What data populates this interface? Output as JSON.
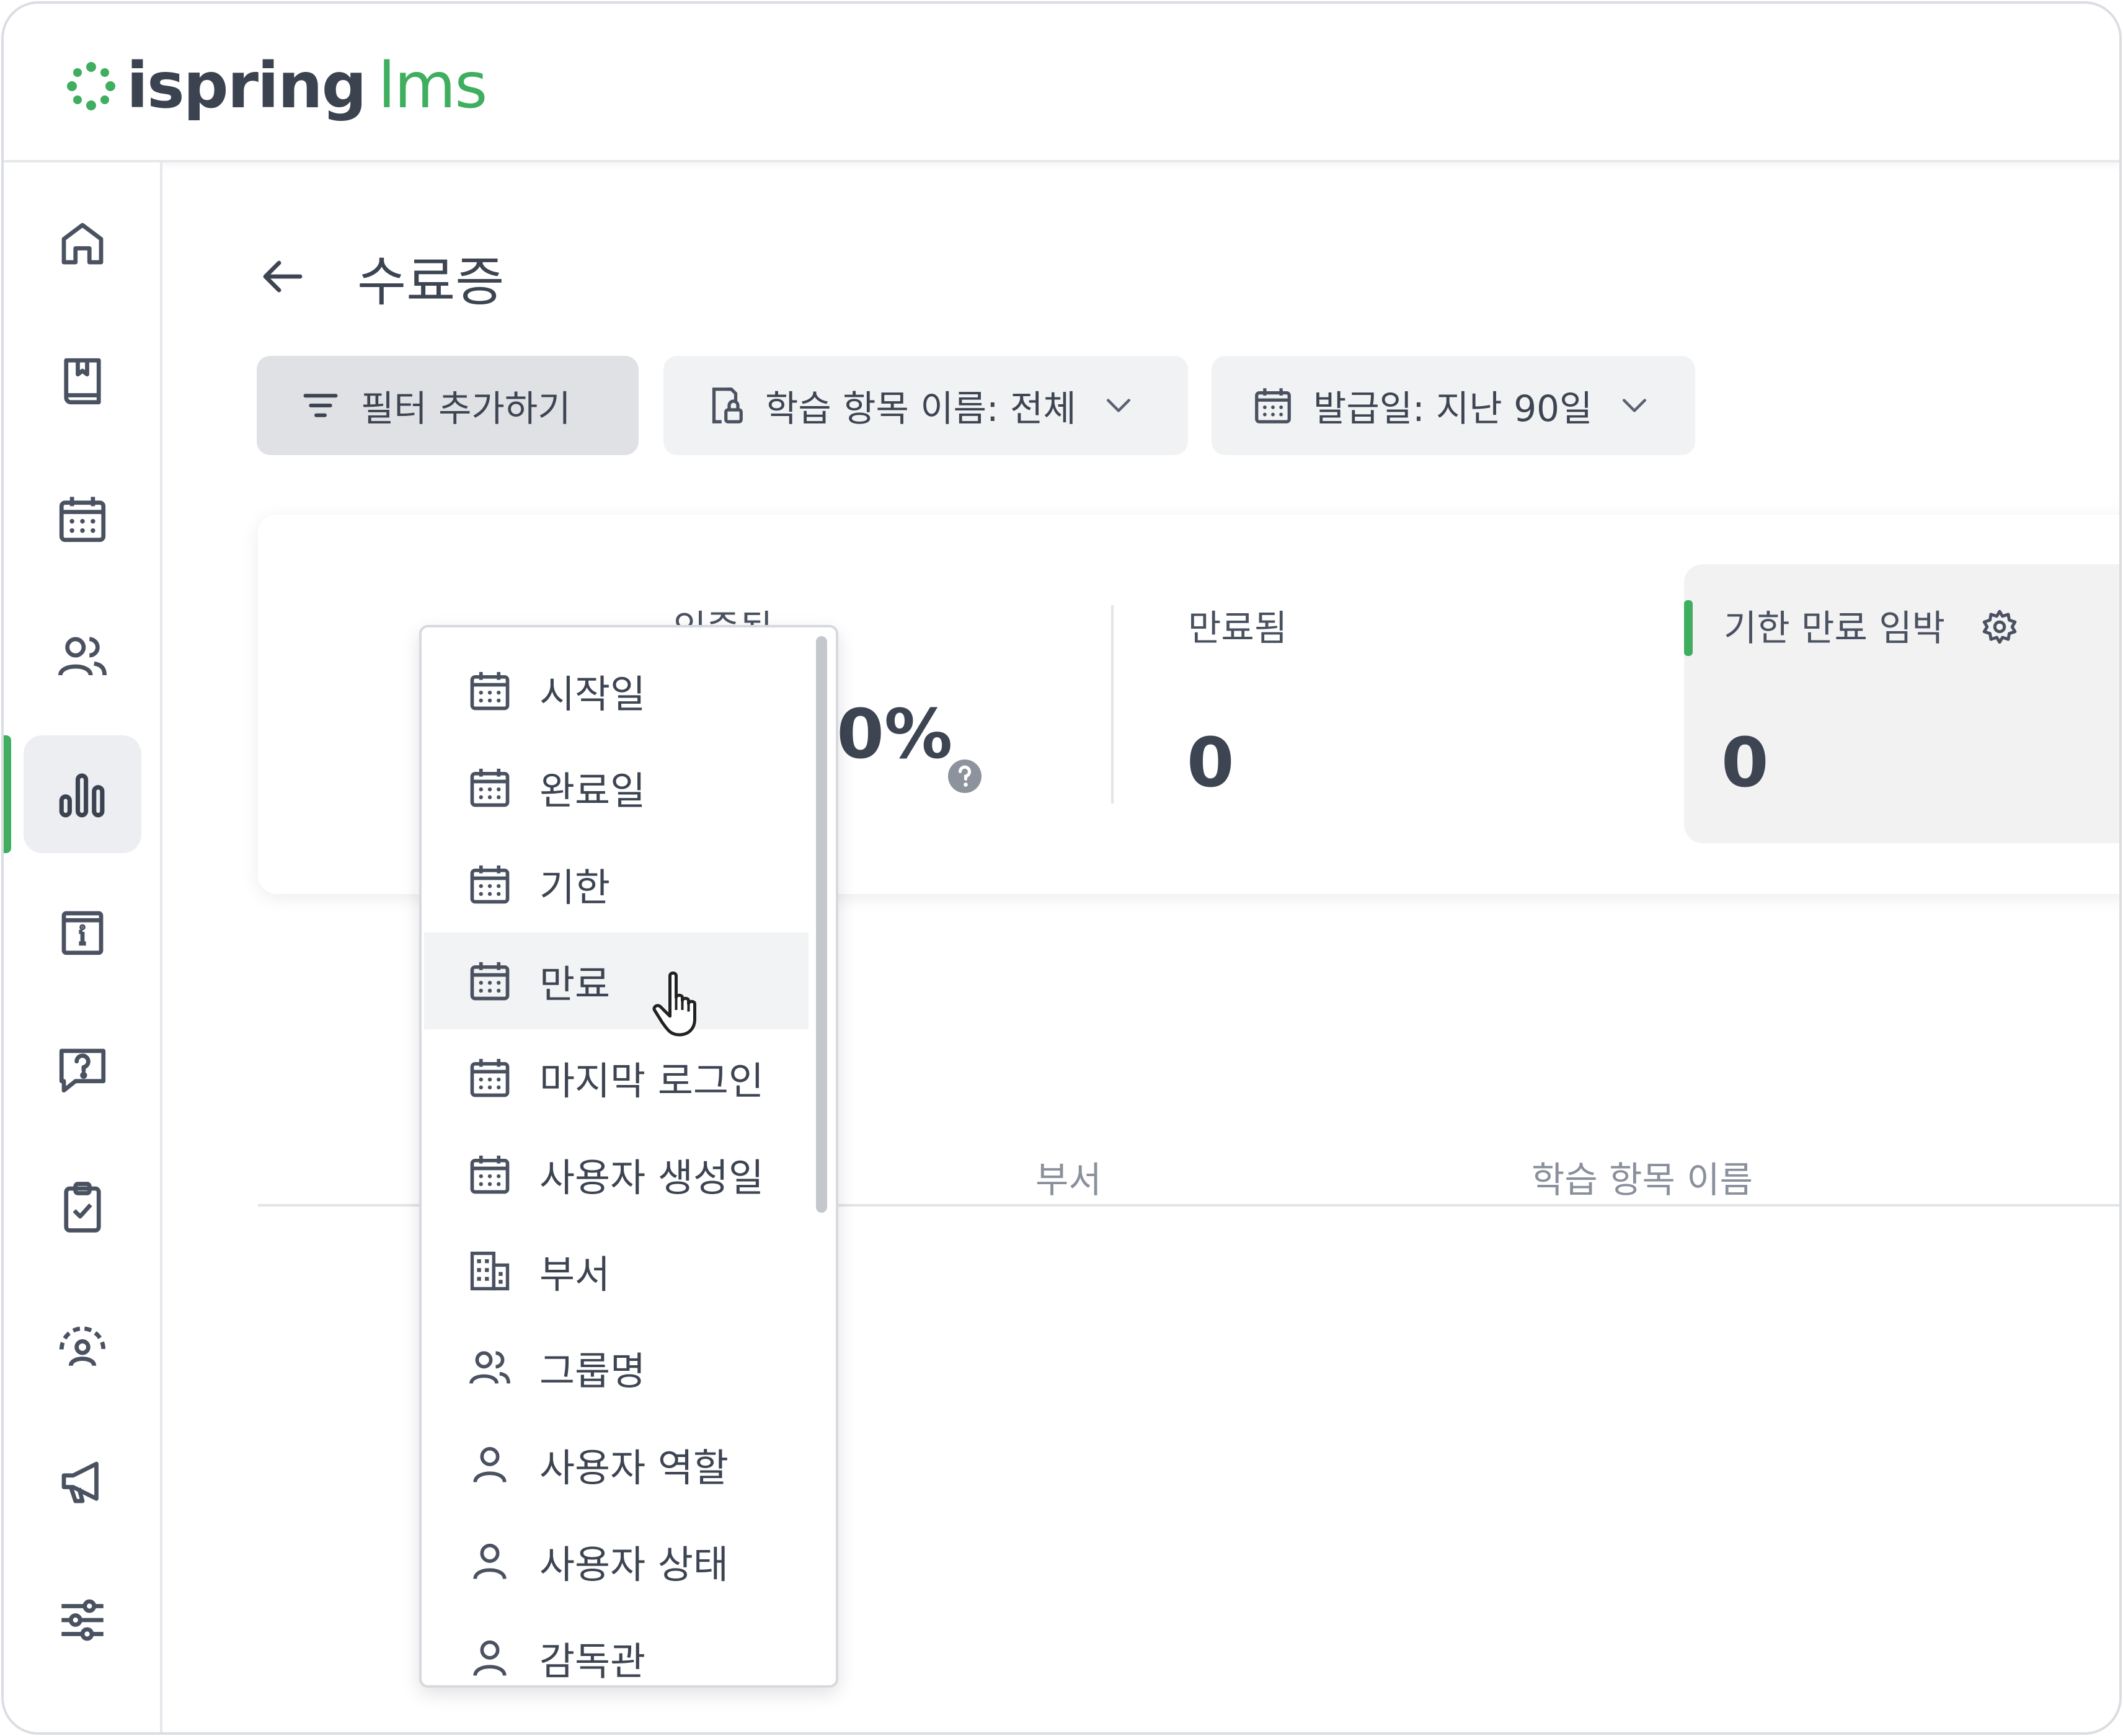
{
  "app": {
    "logo_text": "ispring",
    "logo_suffix": "lms",
    "brand_color": "#3fae5f"
  },
  "sidebar": {
    "items": [
      {
        "name": "home-icon",
        "active": false
      },
      {
        "name": "book-icon",
        "active": false
      },
      {
        "name": "calendar-icon",
        "active": false
      },
      {
        "name": "users-icon",
        "active": false
      },
      {
        "name": "reports-icon",
        "active": true
      },
      {
        "name": "info-icon",
        "active": false
      },
      {
        "name": "question-icon",
        "active": false
      },
      {
        "name": "clipboard-check-icon",
        "active": false
      },
      {
        "name": "gauge-user-icon",
        "active": false
      },
      {
        "name": "megaphone-icon",
        "active": false
      },
      {
        "name": "sliders-icon",
        "active": false
      }
    ]
  },
  "page": {
    "title": "수료증"
  },
  "filters": {
    "add_label": "필터 추가하기",
    "course_label": "학습 항목 이름: 전체",
    "date_label": "발급일: 지난 90일"
  },
  "stats": {
    "certified_label": "인증됨",
    "certified_value": "100.0%",
    "expired_label": "만료됨",
    "expired_value": "0",
    "expiring_label": "기한 만료 임박",
    "expiring_value": "0"
  },
  "table": {
    "columns": [
      "부서",
      "학습 항목 이름"
    ]
  },
  "dropdown": {
    "items": [
      {
        "label": "시작일",
        "icon": "calendar-icon"
      },
      {
        "label": "완료일",
        "icon": "calendar-icon"
      },
      {
        "label": "기한",
        "icon": "calendar-icon"
      },
      {
        "label": "만료",
        "icon": "calendar-icon",
        "hovered": true
      },
      {
        "label": "마지막 로그인",
        "icon": "calendar-icon"
      },
      {
        "label": "사용자 생성일",
        "icon": "calendar-icon"
      },
      {
        "label": "부서",
        "icon": "building-icon"
      },
      {
        "label": "그룹명",
        "icon": "users-icon"
      },
      {
        "label": "사용자 역할",
        "icon": "user-icon"
      },
      {
        "label": "사용자 상태",
        "icon": "user-icon"
      },
      {
        "label": "감독관",
        "icon": "user-icon"
      }
    ]
  }
}
